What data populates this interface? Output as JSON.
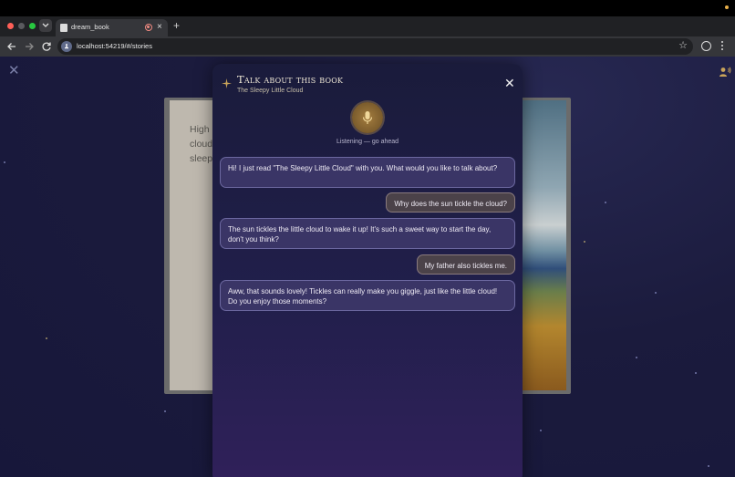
{
  "browser": {
    "tab_title": "dream_book",
    "tab_close": "×",
    "new_tab": "+",
    "url": "localhost:54219/#/stories",
    "bookmark": "☆"
  },
  "page": {
    "close": "✕",
    "book_text_lines": [
      "High",
      "cloud",
      "sleep"
    ]
  },
  "modal": {
    "title": "Talk about this book",
    "subtitle": "The Sleepy Little Cloud",
    "close": "✕",
    "mic_status": "Listening — go ahead",
    "messages": [
      {
        "role": "bot",
        "text": "Hi! I just read \"The Sleepy Little Cloud\" with you. What would you like to talk about?"
      },
      {
        "role": "user",
        "text": "Why does the sun tickle the cloud?"
      },
      {
        "role": "bot",
        "text": "The sun tickles the little cloud to wake it up! It's such a sweet way to start the day, don't you think?"
      },
      {
        "role": "user",
        "text": "My father also tickles me."
      },
      {
        "role": "bot",
        "text": "Aww, that sounds lovely! Tickles can really make you giggle, just like the little cloud! Do you enjoy those moments?"
      }
    ]
  },
  "colors": {
    "accent_gold": "#c9a45a",
    "bot_bubble": "#3a3566",
    "user_bubble": "#4b4249"
  },
  "icons": [
    "chevron-down-icon",
    "favicon-icon",
    "recording-icon",
    "back-arrow-icon",
    "forward-arrow-icon",
    "reload-icon",
    "site-info-icon",
    "star-icon",
    "profile-icon",
    "kebab-menu-icon",
    "close-icon",
    "person-voice-icon",
    "sparkle-icon",
    "microphone-icon"
  ]
}
